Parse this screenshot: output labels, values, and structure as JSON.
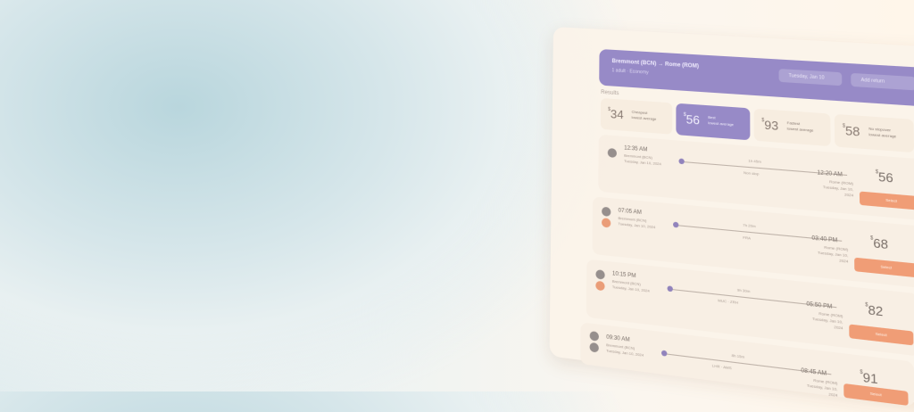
{
  "header": {
    "route": "Bremmont (BCN) → Rome (ROM)",
    "sub": "1 adult · Economy",
    "date_out": "Tuesday, Jan 10",
    "date_ret": "Add return"
  },
  "results_label": "Results",
  "fares": [
    {
      "price": "34",
      "label1": "Cheapest",
      "label2": "lowest average",
      "active": false
    },
    {
      "price": "56",
      "label1": "Best",
      "label2": "lowest average",
      "active": true
    },
    {
      "price": "93",
      "label1": "Fastest",
      "label2": "lowest average",
      "active": false
    },
    {
      "price": "58",
      "label1": "No stopover",
      "label2": "lowest average",
      "active": false
    }
  ],
  "flights": [
    {
      "dep_time": "12:35 AM",
      "dep_city": "Bremmont (BCN)",
      "dep_date": "Tuesday, Jan 10, 2024",
      "duration": "1h 45m",
      "stops": "Non stop",
      "arr_time": "12:20 AM",
      "arr_city": "Rome (ROM)",
      "arr_date": "Tuesday, Jan 10, 2024",
      "price": "56",
      "select": "Select"
    },
    {
      "dep_time": "07:05 AM",
      "dep_city": "Bremmont (BCN)",
      "dep_date": "Tuesday, Jan 10, 2024",
      "duration": "7h 20m",
      "stops": "FRA",
      "arr_time": "03:40 PM",
      "arr_city": "Rome (ROM)",
      "arr_date": "Tuesday, Jan 10, 2024",
      "price": "68",
      "select": "Select"
    },
    {
      "dep_time": "10:15 PM",
      "dep_city": "Bremmont (BCN)",
      "dep_date": "Tuesday, Jan 10, 2024",
      "duration": "9h 30m",
      "stops": "MUC · ZRH",
      "arr_time": "05:50 PM",
      "arr_city": "Rome (ROM)",
      "arr_date": "Tuesday, Jan 10, 2024",
      "price": "82",
      "select": "Select"
    },
    {
      "dep_time": "09:30 AM",
      "dep_city": "Bremmont (BCN)",
      "dep_date": "Tuesday, Jan 10, 2024",
      "duration": "8h 15m",
      "stops": "LHR · AMS",
      "arr_time": "08:45 AM",
      "arr_city": "Rome (ROM)",
      "arr_date": "Tuesday, Jan 10, 2024",
      "price": "91",
      "select": "Select"
    }
  ]
}
